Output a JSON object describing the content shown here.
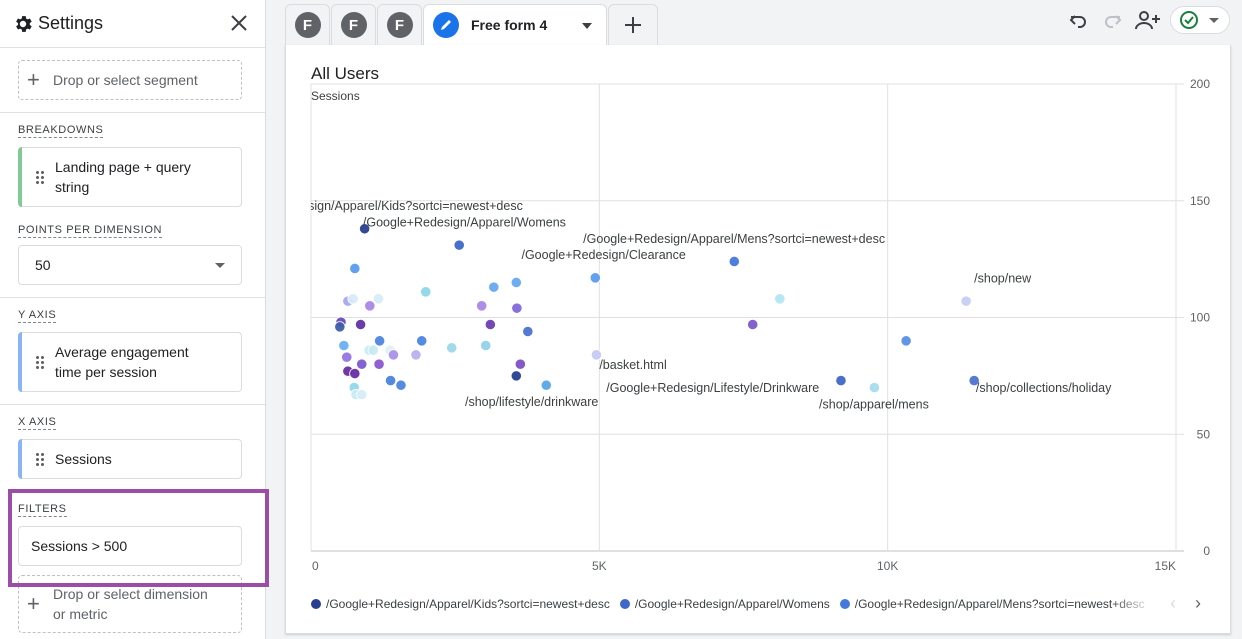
{
  "sidebar": {
    "title": "Settings",
    "segment_placeholder": "Drop or select segment",
    "breakdowns": {
      "label": "BREAKDOWNS",
      "chip": "Landing page + query string",
      "chip_line1": "Landing page + query",
      "chip_line2": "string",
      "color": "#81c995"
    },
    "points_per_dimension": {
      "label": "POINTS PER DIMENSION",
      "value": "50"
    },
    "y_axis": {
      "label": "Y AXIS",
      "chip_line1": "Average engagement",
      "chip_line2": "time per session",
      "color": "#8ab4f8"
    },
    "x_axis": {
      "label": "X AXIS",
      "chip": "Sessions",
      "color": "#8ab4f8"
    },
    "filters": {
      "label": "FILTERS",
      "value": "Sessions > 500",
      "drop_line1": "Drop or select dimension",
      "drop_line2": "or metric",
      "highlight_color": "#9b4ea6"
    }
  },
  "tabs": [
    {
      "badge": "F"
    },
    {
      "badge": "F"
    },
    {
      "badge": "F"
    },
    {
      "label": "Free form 4",
      "active": true,
      "icon": "pencil-icon"
    }
  ],
  "toolbar": {
    "icons": [
      "undo-icon",
      "redo-icon",
      "share-icon",
      "check-circle-icon"
    ],
    "status_color": "#188038"
  },
  "chart_data": {
    "type": "scatter",
    "title": "All Users",
    "ylabel": "Sessions",
    "xlabel": "",
    "xlim": [
      0,
      15000
    ],
    "ylim": [
      0,
      200
    ],
    "x_ticks": [
      "0",
      "5K",
      "10K",
      "15K"
    ],
    "x_tick_values": [
      0,
      5000,
      10000,
      15000
    ],
    "y_ticks": [
      "0",
      "50",
      "100",
      "150",
      "200"
    ],
    "y_tick_values": [
      0,
      50,
      100,
      150,
      200
    ],
    "grid": true,
    "legend_placement": "bottom",
    "legend": [
      {
        "name": "/Google+Redesign/Apparel/Kids?sortci=newest+desc",
        "color": "#283f8f"
      },
      {
        "name": "/Google+Redesign/Apparel/Womens",
        "color": "#3e67c9"
      },
      {
        "name": "/Google+Redesign/Apparel/Mens?sortci=newest+desc",
        "color": "#4678dc"
      }
    ],
    "labels": [
      {
        "text": "sign/Apparel/Kids?sortci=newest+desc",
        "x": -50,
        "y": 146
      },
      {
        "text": "/Google+Redesign/Apparel/Womens",
        "x": 900,
        "y": 139
      },
      {
        "text": "/Google+Redesign/Apparel/Mens?sortci=newest+desc",
        "x": 4720,
        "y": 132
      },
      {
        "text": "/Google+Redesign/Clearance",
        "x": 3650,
        "y": 125
      },
      {
        "text": "/shop/new",
        "x": 11500,
        "y": 115
      },
      {
        "text": "/basket.html",
        "x": 5000,
        "y": 78
      },
      {
        "text": "/Google+Redesign/Lifestyle/Drinkware",
        "x": 5120,
        "y": 68
      },
      {
        "text": "/shop/lifestyle/drinkware",
        "x": 2670,
        "y": 62
      },
      {
        "text": "/shop/apparel/mens",
        "x": 8810,
        "y": 61
      },
      {
        "text": "/shop/collections/holiday",
        "x": 11530,
        "y": 68
      }
    ],
    "points": [
      {
        "x": 930,
        "y": 138,
        "color": "#283f8f"
      },
      {
        "x": 2570,
        "y": 131,
        "color": "#3e67c9"
      },
      {
        "x": 7340,
        "y": 124,
        "color": "#4678dc"
      },
      {
        "x": 4930,
        "y": 117,
        "color": "#5a9bef"
      },
      {
        "x": 11360,
        "y": 107,
        "color": "#c6cdf5"
      },
      {
        "x": 760,
        "y": 121,
        "color": "#5a9bef"
      },
      {
        "x": 3560,
        "y": 115,
        "color": "#67a9f1"
      },
      {
        "x": 3170,
        "y": 113,
        "color": "#67a9f1"
      },
      {
        "x": 1990,
        "y": 111,
        "color": "#8ed6ea"
      },
      {
        "x": 8130,
        "y": 108,
        "color": "#b4e5f4"
      },
      {
        "x": 640,
        "y": 107,
        "color": "#a9a8f0"
      },
      {
        "x": 730,
        "y": 108,
        "color": "#d6ecf7"
      },
      {
        "x": 1170,
        "y": 108,
        "color": "#d6ecf7"
      },
      {
        "x": 1020,
        "y": 105,
        "color": "#a887e6"
      },
      {
        "x": 2960,
        "y": 105,
        "color": "#a887e6"
      },
      {
        "x": 3570,
        "y": 104,
        "color": "#8468dd"
      },
      {
        "x": 520,
        "y": 98,
        "color": "#6b4ab8"
      },
      {
        "x": 500,
        "y": 96,
        "color": "#3e5fa8"
      },
      {
        "x": 860,
        "y": 97,
        "color": "#6133a5"
      },
      {
        "x": 3110,
        "y": 97,
        "color": "#6b3fb3"
      },
      {
        "x": 7660,
        "y": 97,
        "color": "#7c58cb"
      },
      {
        "x": 3760,
        "y": 94,
        "color": "#4d73cf"
      },
      {
        "x": 10320,
        "y": 90,
        "color": "#5a8ee6"
      },
      {
        "x": 1190,
        "y": 90,
        "color": "#4d85e0"
      },
      {
        "x": 1920,
        "y": 90,
        "color": "#4d85e0"
      },
      {
        "x": 570,
        "y": 88,
        "color": "#6ab0f0"
      },
      {
        "x": 3030,
        "y": 88,
        "color": "#90d2ec"
      },
      {
        "x": 2440,
        "y": 87,
        "color": "#9ed8ea"
      },
      {
        "x": 1010,
        "y": 86,
        "color": "#c8eaf4"
      },
      {
        "x": 1080,
        "y": 86,
        "color": "#c8eaf4"
      },
      {
        "x": 1370,
        "y": 86,
        "color": "#e1eff5"
      },
      {
        "x": 1430,
        "y": 84,
        "color": "#a891ea"
      },
      {
        "x": 1820,
        "y": 84,
        "color": "#b9b1ef"
      },
      {
        "x": 4950,
        "y": 84,
        "color": "#c6caf2"
      },
      {
        "x": 620,
        "y": 83,
        "color": "#9575e1"
      },
      {
        "x": 880,
        "y": 80,
        "color": "#7d5ad4"
      },
      {
        "x": 1180,
        "y": 80,
        "color": "#8a59d0"
      },
      {
        "x": 3630,
        "y": 80,
        "color": "#8050c8"
      },
      {
        "x": 640,
        "y": 77,
        "color": "#6a2ca7"
      },
      {
        "x": 760,
        "y": 76,
        "color": "#6a2ca7"
      },
      {
        "x": 3560,
        "y": 75,
        "color": "#283f8f"
      },
      {
        "x": 1380,
        "y": 73,
        "color": "#4a84de"
      },
      {
        "x": 1560,
        "y": 71,
        "color": "#4d85e0"
      },
      {
        "x": 4080,
        "y": 71,
        "color": "#5aa6ea"
      },
      {
        "x": 9190,
        "y": 73,
        "color": "#3e67c9"
      },
      {
        "x": 11500,
        "y": 73,
        "color": "#4d73cf"
      },
      {
        "x": 9770,
        "y": 70,
        "color": "#a6dcee"
      },
      {
        "x": 750,
        "y": 70,
        "color": "#90d8ea"
      },
      {
        "x": 780,
        "y": 67,
        "color": "#c8eaf4"
      },
      {
        "x": 880,
        "y": 67,
        "color": "#d6ecf7"
      }
    ]
  }
}
